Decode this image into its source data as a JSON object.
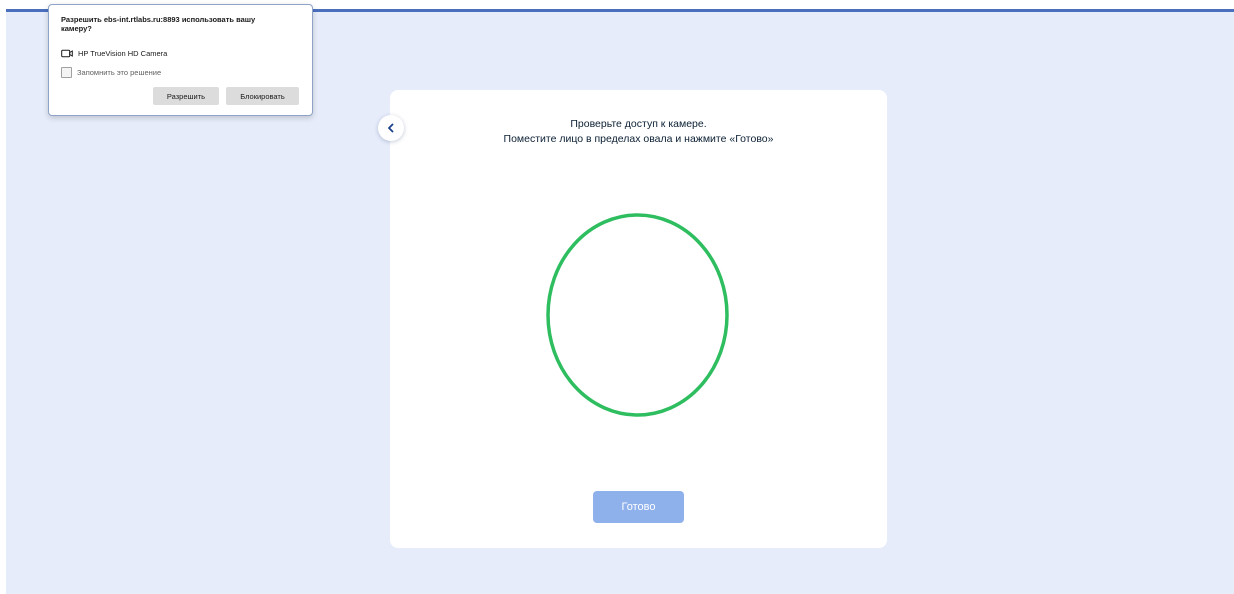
{
  "permission_popup": {
    "title": "Разрешить ebs-int.rtlabs.ru:8893 использовать вашу камеру?",
    "device_name": "HP TrueVision HD Camera",
    "remember_label": "Запомнить это решение",
    "remember_checked": false,
    "allow_label": "Разрешить",
    "block_label": "Блокировать",
    "device_icon": "camera-icon"
  },
  "card": {
    "back_icon": "chevron-left-icon",
    "instruction_line1": "Проверьте доступ к камере.",
    "instruction_line2": "Поместите лицо в пределах овала и нажмите «Готово»",
    "done_label": "Готово"
  },
  "colors": {
    "oval": "#2ebd5f",
    "done_button": "#8eb0eb",
    "accent_bar": "#4a6fbd",
    "background": "#e6ecfa"
  }
}
